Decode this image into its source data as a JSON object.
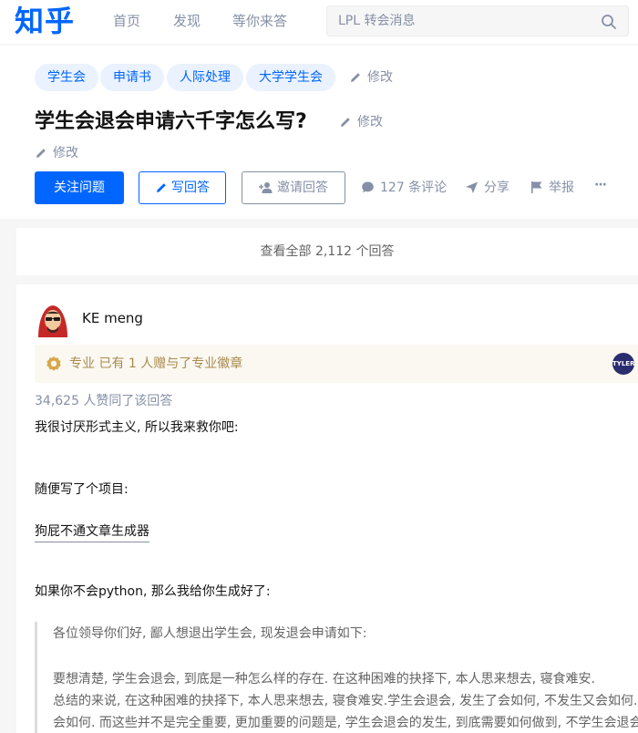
{
  "header": {
    "logo": "知乎",
    "nav": [
      "首页",
      "发现",
      "等你来答"
    ],
    "search": {
      "placeholder": "LPL 转会消息"
    }
  },
  "question": {
    "tags": [
      "学生会",
      "申请书",
      "人际处理",
      "大学学生会"
    ],
    "edit_label": "修改",
    "title": "学生会退会申请六千字怎么写?",
    "buttons": {
      "follow": "关注问题",
      "answer": "写回答",
      "invite": "邀请回答"
    },
    "actions": {
      "comments": "127 条评论",
      "share": "分享",
      "report": "举报",
      "more": "···"
    }
  },
  "view_all": "查看全部 2,112 个回答",
  "answer": {
    "author": "KE meng",
    "badge": "专业  已有 1 人赠与了专业徽章",
    "badge_avatar": "TYLER",
    "votes": "34,625 人赞同了该回答",
    "paragraphs": [
      "我很讨厌形式主义, 所以我来救你吧:",
      "随便写了个项目:",
      "狗屁不通文章生成器",
      "如果你不会python, 那么我给你生成好了:"
    ],
    "quote": [
      "各位领导你们好, 鄙人想退出学生会, 现发退会申请如下:",
      "要想清楚, 学生会退会, 到底是一种怎么样的存在. 在这种困难的抉择下, 本人思来想去, 寝食难安.",
      "总结的来说, 在这种困难的抉择下, 本人思来想去, 寝食难安.学生会退会, 发生了会如何, 不发生又会如何.",
      "会如何. 而这些并不是完全重要, 更加重要的问题是, 学生会退会的发生, 到底需要如何做到, 不学生会退会"
    ]
  },
  "colors": {
    "brand": "#0066ff",
    "muted": "#8590a6",
    "badge_text": "#a98a4f"
  }
}
